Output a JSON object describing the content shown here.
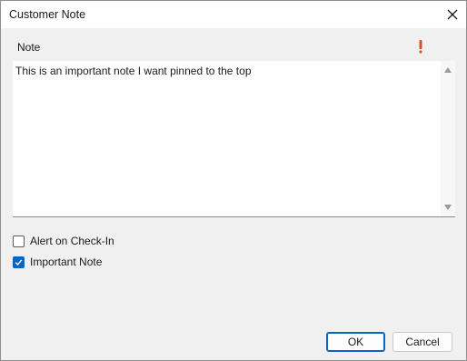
{
  "window": {
    "title": "Customer Note",
    "close_icon": "close-icon"
  },
  "note": {
    "label": "Note",
    "important_icon": "exclamation-icon",
    "important_color": "#d9531e",
    "text": "This is an important note I want pinned to the top"
  },
  "options": {
    "alert_on_checkin": {
      "label": "Alert on Check-In",
      "checked": false
    },
    "important_note": {
      "label": "Important Note",
      "checked": true
    }
  },
  "buttons": {
    "ok": "OK",
    "cancel": "Cancel"
  },
  "colors": {
    "accent": "#0a64c2"
  }
}
